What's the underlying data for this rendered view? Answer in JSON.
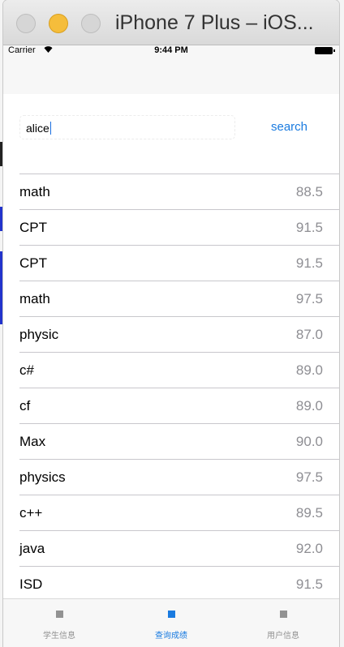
{
  "window": {
    "title": "iPhone 7 Plus – iOS..."
  },
  "status_bar": {
    "carrier": "Carrier",
    "time": "9:44 PM"
  },
  "search": {
    "value": "alice",
    "button_label": "search"
  },
  "scores": [
    {
      "subject": "math",
      "score": "88.5"
    },
    {
      "subject": "CPT",
      "score": "91.5"
    },
    {
      "subject": "CPT",
      "score": "91.5"
    },
    {
      "subject": "math",
      "score": "97.5"
    },
    {
      "subject": "physic",
      "score": "87.0"
    },
    {
      "subject": "c#",
      "score": "89.0"
    },
    {
      "subject": "cf",
      "score": "89.0"
    },
    {
      "subject": "Max",
      "score": "90.0"
    },
    {
      "subject": "physics",
      "score": "97.5"
    },
    {
      "subject": "c++",
      "score": "89.5"
    },
    {
      "subject": "java",
      "score": "92.0"
    },
    {
      "subject": "ISD",
      "score": "91.5"
    }
  ],
  "tab_bar": {
    "tabs": [
      {
        "label": "学生信息",
        "active": false
      },
      {
        "label": "查询成绩",
        "active": true
      },
      {
        "label": "用户信息",
        "active": false
      }
    ]
  },
  "colors": {
    "accent": "#1a7be0",
    "inactive": "#929292",
    "score_text": "#8e8e93"
  }
}
